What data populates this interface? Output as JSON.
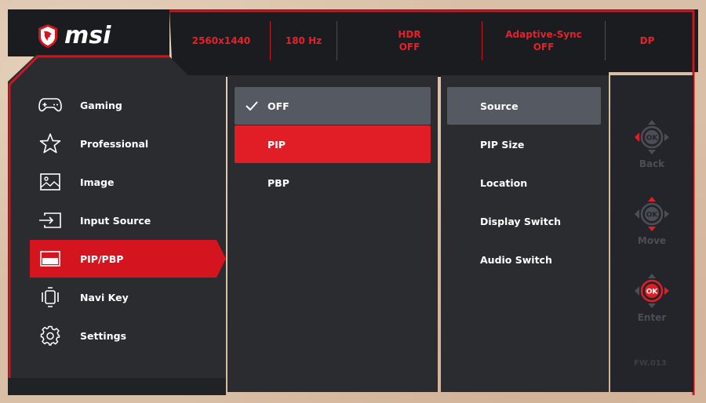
{
  "brand": {
    "name": "msi",
    "logo_icon": "msi-dragon-shield-icon"
  },
  "status_bar": [
    {
      "lines": [
        "2560x1440"
      ]
    },
    {
      "lines": [
        "180 Hz"
      ]
    },
    {
      "lines": [
        "HDR",
        "OFF"
      ]
    },
    {
      "lines": [
        "Adaptive-Sync",
        "OFF"
      ]
    },
    {
      "lines": [
        "DP"
      ]
    }
  ],
  "main_menu": [
    {
      "label": "Gaming",
      "icon": "gamepad-icon",
      "active": false
    },
    {
      "label": "Professional",
      "icon": "star-icon",
      "active": false
    },
    {
      "label": "Image",
      "icon": "image-icon",
      "active": false
    },
    {
      "label": "Input Source",
      "icon": "input-source-icon",
      "active": false
    },
    {
      "label": "PIP/PBP",
      "icon": "pip-icon",
      "active": true
    },
    {
      "label": "Navi Key",
      "icon": "navi-key-icon",
      "active": false
    },
    {
      "label": "Settings",
      "icon": "gear-icon",
      "active": false
    }
  ],
  "options": [
    {
      "label": "OFF",
      "state": "selected",
      "checked": true
    },
    {
      "label": "PIP",
      "state": "hover",
      "checked": false
    },
    {
      "label": "PBP",
      "state": "normal",
      "checked": false
    }
  ],
  "submenu": [
    {
      "label": "Source",
      "selected": true
    },
    {
      "label": "PIP Size",
      "selected": false
    },
    {
      "label": "Location",
      "selected": false
    },
    {
      "label": "Display Switch",
      "selected": false
    },
    {
      "label": "Audio Switch",
      "selected": false
    }
  ],
  "navigation": [
    {
      "label": "Back",
      "icon": "joystick-left-icon",
      "highlight": "left"
    },
    {
      "label": "Move",
      "icon": "joystick-up-down-icon",
      "highlight": "updown"
    },
    {
      "label": "Enter",
      "icon": "joystick-right-icon",
      "highlight": "right"
    }
  ],
  "center_key_label": "OK",
  "firmware": "FW.013",
  "colors": {
    "accent_red": "#d4151f",
    "status_red": "#e8202a",
    "panel_dark": "#2a2c30",
    "selected_gray": "#555961"
  }
}
